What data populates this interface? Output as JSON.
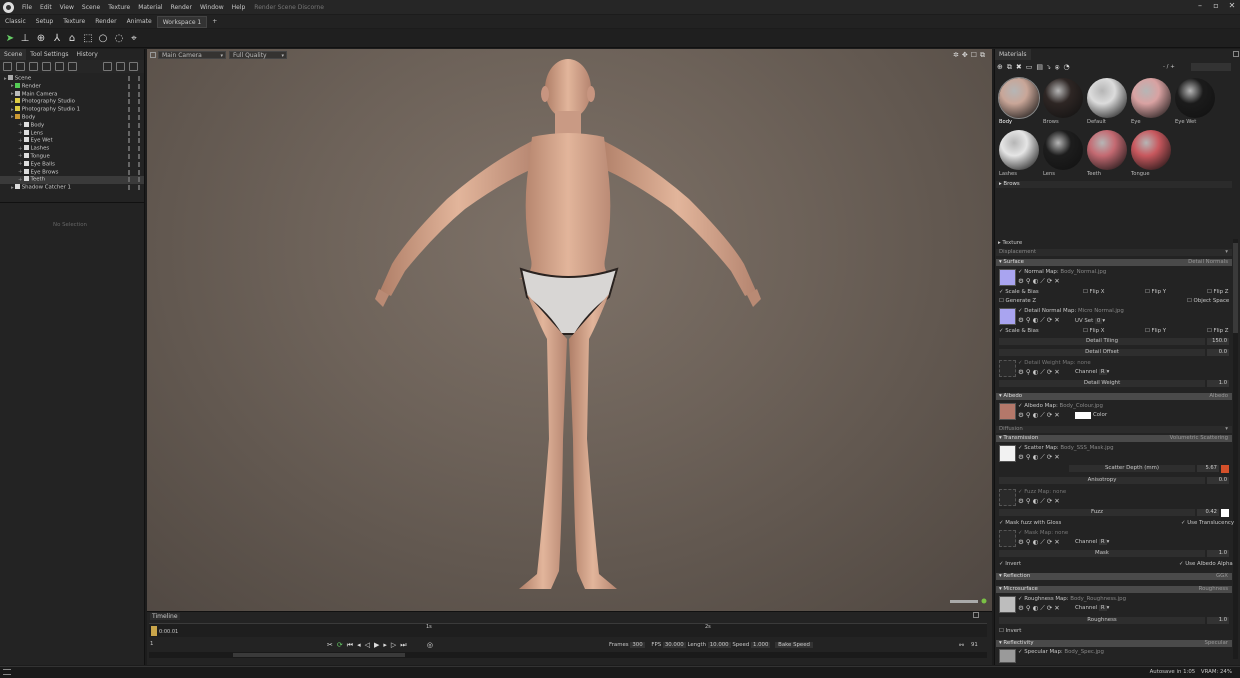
{
  "titlebar": {
    "menus": [
      "File",
      "Edit",
      "View",
      "Scene",
      "Texture",
      "Material",
      "Render",
      "Window",
      "Help"
    ],
    "title": "Render Scene Discorne"
  },
  "workspaces": [
    "Classic",
    "Setup",
    "Texture",
    "Render",
    "Animate",
    "Workspace 1"
  ],
  "left": {
    "tabs": [
      "Scene",
      "Tool Settings",
      "History"
    ],
    "tree": [
      {
        "label": "Scene",
        "depth": 0,
        "icon": "#aaa"
      },
      {
        "label": "Render",
        "depth": 1,
        "icon": "#5c5"
      },
      {
        "label": "Main Camera",
        "depth": 1,
        "icon": "#bbb"
      },
      {
        "label": "Photography Studio",
        "depth": 1,
        "icon": "#dc4"
      },
      {
        "label": "Photography Studio 1",
        "depth": 1,
        "icon": "#dc4"
      },
      {
        "label": "Body",
        "depth": 1,
        "icon": "#c93"
      },
      {
        "label": "Body",
        "depth": 2,
        "icon": "#ddd"
      },
      {
        "label": "Lens",
        "depth": 2,
        "icon": "#ddd"
      },
      {
        "label": "Eye Wet",
        "depth": 2,
        "icon": "#ddd"
      },
      {
        "label": "Lashes",
        "depth": 2,
        "icon": "#ddd"
      },
      {
        "label": "Tongue",
        "depth": 2,
        "icon": "#ddd"
      },
      {
        "label": "Eye Balls",
        "depth": 2,
        "icon": "#ddd"
      },
      {
        "label": "Eye Brows",
        "depth": 2,
        "icon": "#ddd"
      },
      {
        "label": "Teeth",
        "depth": 2,
        "icon": "#ddd",
        "selected": true
      },
      {
        "label": "Shadow Catcher 1",
        "depth": 1,
        "icon": "#ddd"
      }
    ],
    "no_selection": "No Selection"
  },
  "viewport": {
    "camera": "Main Camera",
    "quality": "Full Quality"
  },
  "timeline": {
    "title": "Timeline",
    "time": "0:00.01",
    "mark1": "1s",
    "mark2": "2s",
    "frame_start": "1",
    "frames_label": "Frames",
    "frames": "300",
    "fps_label": "FPS",
    "fps": "30.000",
    "length_label": "Length",
    "length": "10.000",
    "speed_label": "Speed",
    "speed": "1.000",
    "bake": "Bake Speed",
    "frame_end": "91"
  },
  "materials": {
    "title": "Materials",
    "pager": "- / +",
    "items": [
      {
        "label": "Body",
        "color": "#c9a698",
        "sel": true
      },
      {
        "label": "Brows",
        "color": "#2e2624"
      },
      {
        "label": "Default",
        "color": "#dcdcdc"
      },
      {
        "label": "Eye",
        "color": "#d9a2a2"
      },
      {
        "label": "Eye Wet",
        "color": "#1b1b1b"
      },
      {
        "label": "Lashes",
        "color": "#e5e5e5"
      },
      {
        "label": "Lens",
        "color": "#1d1d1d"
      },
      {
        "label": "Teeth",
        "color": "#c46a72"
      },
      {
        "label": "Tongue",
        "color": "#c8585e"
      }
    ]
  },
  "props": {
    "brows": "Brows",
    "texture": "Texture",
    "displacement": "Displacement",
    "surface": "Surface",
    "surface_mode": "Detail Normals",
    "normal_map": "Normal Map:",
    "normal_file": "Body_Normal.jpg",
    "scale_bias": "Scale & Bias",
    "flip_x": "Flip X",
    "flip_y": "Flip Y",
    "flip_z": "Flip Z",
    "generate_z": "Generate Z",
    "object_space": "Object Space",
    "detail_normal": "Detail Normal Map:",
    "detail_normal_file": "Micro Normal.jpg",
    "uv_set": "UV Set",
    "uv_val": "0",
    "detail_tiling": "Detail Tiling",
    "detail_tiling_val": "150.0",
    "detail_offset": "Detail Offset",
    "detail_offset_val": "0.0",
    "detail_weight_map": "Detail Weight Map:",
    "none": "none",
    "channel": "Channel",
    "channel_val": "R",
    "detail_weight": "Detail Weight",
    "detail_weight_val": "1.0",
    "albedo": "Albedo",
    "albedo_mode": "Albedo",
    "albedo_map": "Albedo Map:",
    "albedo_file": "Body_Colour.jpg",
    "color": "Color",
    "diffusion": "Diffusion",
    "transmission": "Transmission",
    "transmission_mode": "Volumetric Scattering",
    "scatter_map": "Scatter Map:",
    "scatter_file": "Body_SSS_Mask.jpg",
    "scatter_depth": "Scatter Depth (mm)",
    "scatter_depth_val": "5.67",
    "anisotropy": "Anisotropy",
    "anisotropy_val": "0.0",
    "fuzz_map": "Fuzz Map:",
    "fuzz": "Fuzz",
    "fuzz_val": "0.42",
    "mask_fuzz": "Mask fuzz with Gloss",
    "use_translucency": "Use Translucency",
    "mask_map": "Mask Map:",
    "mask": "Mask",
    "mask_val": "1.0",
    "invert": "Invert",
    "use_albedo_alpha": "Use Albedo Alpha",
    "reflection": "Reflection",
    "reflection_mode": "GGX",
    "microsurface": "Microsurface",
    "microsurface_mode": "Roughness",
    "roughness_map": "Roughness Map:",
    "roughness_file": "Body_Roughness.jpg",
    "roughness": "Roughness",
    "roughness_val": "1.0",
    "invert2": "Invert",
    "reflectivity": "Reflectivity",
    "reflectivity_mode": "Specular",
    "specular_map": "Specular Map:",
    "specular_file": "Body_Spec.jpg"
  },
  "status": {
    "autosave": "Autosave in 1:05",
    "vram": "VRAM: 24%"
  },
  "colors": {
    "accent": "#e06020",
    "orange_swatch": "#d4502a"
  }
}
